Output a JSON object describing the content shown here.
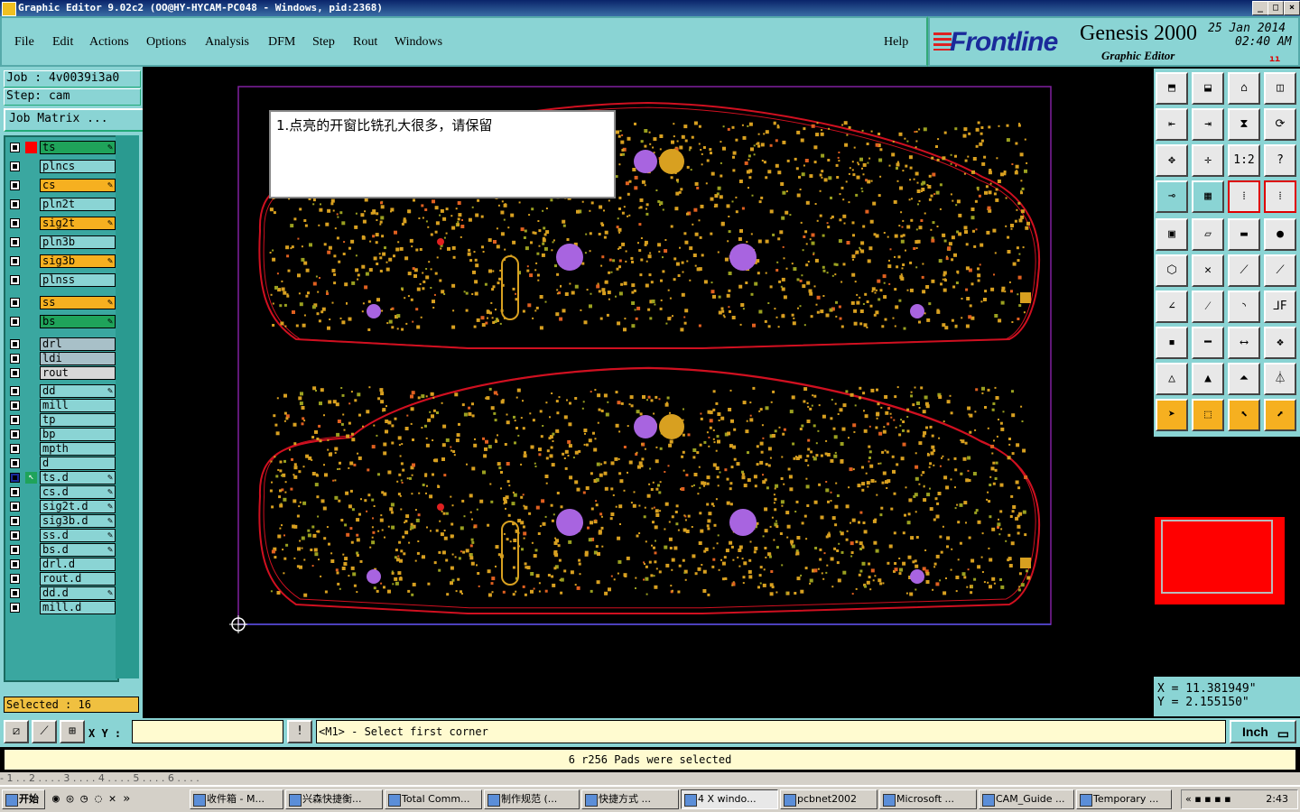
{
  "window": {
    "title": "Graphic Editor 9.02c2 (OO@HY-HYCAM-PC048 - Windows, pid:2368)"
  },
  "menu": {
    "items": [
      "File",
      "Edit",
      "Actions",
      "Options",
      "Analysis",
      "DFM",
      "Step",
      "Rout",
      "Windows"
    ],
    "help": "Help"
  },
  "logo": {
    "brand": "Frontline",
    "product": "Genesis 2000",
    "subtitle": "Graphic Editor",
    "date": "25 Jan 2014",
    "time": "02:40 AM"
  },
  "job": {
    "job_label": "Job : 4v0039i3a0",
    "step_label": "Step: cam",
    "matrix_button": "Job Matrix ..."
  },
  "layers": [
    {
      "name": "ts",
      "color": "#1fa35a",
      "pen": true,
      "marker": "#f00"
    },
    {
      "name": "plncs",
      "color": "#8ad4d4",
      "pen": false
    },
    {
      "name": "cs",
      "color": "#f6b020",
      "pen": true
    },
    {
      "name": "pln2t",
      "color": "#8ad4d4",
      "pen": false
    },
    {
      "name": "sig2t",
      "color": "#f6b020",
      "pen": true
    },
    {
      "name": "pln3b",
      "color": "#8ad4d4",
      "pen": false
    },
    {
      "name": "sig3b",
      "color": "#f6b020",
      "pen": true
    },
    {
      "name": "plnss",
      "color": "#8ad4d4",
      "pen": false
    },
    {
      "name": "ss",
      "color": "#f6b020",
      "pen": true
    },
    {
      "name": "bs",
      "color": "#1fa35a",
      "pen": true
    },
    {
      "name": "drl",
      "color": "#a8c0c8",
      "pen": false
    },
    {
      "name": "ldi",
      "color": "#a8c0c8",
      "pen": false
    },
    {
      "name": "rout",
      "color": "#d8d8d8",
      "pen": false
    },
    {
      "name": "dd",
      "color": "#8ad4d4",
      "pen": true
    },
    {
      "name": "mill",
      "color": "#8ad4d4",
      "pen": false
    },
    {
      "name": "tp",
      "color": "#8ad4d4",
      "pen": false
    },
    {
      "name": "bp",
      "color": "#8ad4d4",
      "pen": false
    },
    {
      "name": "mpth",
      "color": "#8ad4d4",
      "pen": false
    },
    {
      "name": "d",
      "color": "#8ad4d4",
      "pen": false
    },
    {
      "name": "ts.d",
      "color": "#8ad4d4",
      "pen": true,
      "active": true
    },
    {
      "name": "cs.d",
      "color": "#8ad4d4",
      "pen": true
    },
    {
      "name": "sig2t.d",
      "color": "#8ad4d4",
      "pen": true
    },
    {
      "name": "sig3b.d",
      "color": "#8ad4d4",
      "pen": true
    },
    {
      "name": "ss.d",
      "color": "#8ad4d4",
      "pen": true
    },
    {
      "name": "bs.d",
      "color": "#8ad4d4",
      "pen": true
    },
    {
      "name": "drl.d",
      "color": "#8ad4d4",
      "pen": false
    },
    {
      "name": "rout.d",
      "color": "#8ad4d4",
      "pen": false
    },
    {
      "name": "dd.d",
      "color": "#8ad4d4",
      "pen": true
    },
    {
      "name": "mill.d",
      "color": "#8ad4d4",
      "pen": false
    }
  ],
  "selected_label": "Selected : 16",
  "note_text": "1.点亮的开窗比铣孔大很多，请保留",
  "coords": {
    "x": "X = 11.381949\"",
    "y": "Y = 2.155150\""
  },
  "bottom": {
    "xy_label": "X Y :",
    "xy_value": "",
    "message": "<M1> - Select first corner",
    "unit": "Inch"
  },
  "status": "6 r256 Pads were selected",
  "prev_window_text": "- 1 . . 2 . . . . 3 . . . . 4 . . . . 5 . . . . 6 . . . .",
  "taskbar": {
    "start": "开始",
    "tasks": [
      "收件箱 - M...",
      "兴森快捷衡...",
      "Total Comm...",
      "制作规范 (...",
      "快捷方式 ...",
      "4 X windo...",
      "pcbnet2002",
      "Microsoft ...",
      "CAM_Guide ...",
      "Temporary ..."
    ],
    "clock": "2:43"
  },
  "colors": {
    "board_outline": "#d01020",
    "pad": "#d8a020",
    "via": "#a864e0",
    "selection_frame": "#8020a0"
  }
}
